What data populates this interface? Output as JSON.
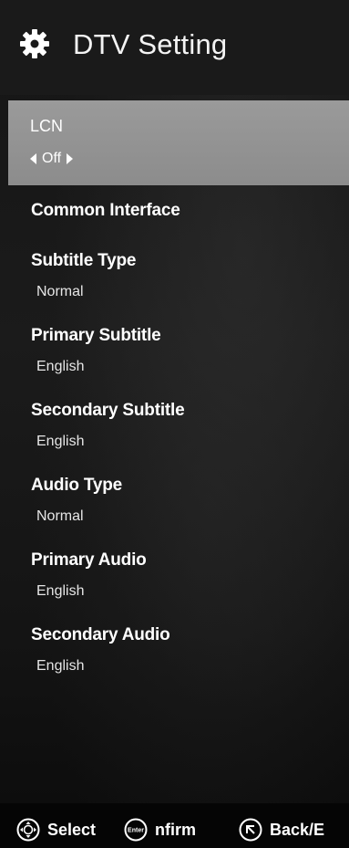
{
  "header": {
    "icon": "gear-icon",
    "title": "DTV Setting"
  },
  "selected_item": {
    "label": "LCN",
    "value": "Off"
  },
  "items": [
    {
      "label": "Common Interface",
      "value": null
    },
    {
      "label": "Subtitle Type",
      "value": "Normal"
    },
    {
      "label": "Primary Subtitle",
      "value": "English"
    },
    {
      "label": "Secondary Subtitle",
      "value": "English"
    },
    {
      "label": "Audio Type",
      "value": "Normal"
    },
    {
      "label": "Primary Audio",
      "value": "English"
    },
    {
      "label": "Secondary Audio",
      "value": "English"
    }
  ],
  "footer": {
    "select": {
      "icon": "dpad-icon",
      "label": "Select"
    },
    "confirm": {
      "icon": "enter-icon",
      "icon_text": "Enter",
      "label": "nfirm"
    },
    "back": {
      "icon": "back-icon",
      "label": "Back/E"
    }
  },
  "colors": {
    "highlight": "#8f8f8f",
    "header_bg": "#1a1a1a",
    "text": "#ffffff"
  }
}
